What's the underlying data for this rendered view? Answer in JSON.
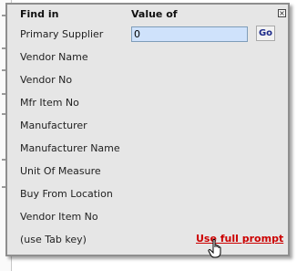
{
  "popup": {
    "header_find": "Find in",
    "header_value": "Value of",
    "close_icon": "close-icon",
    "fields": [
      "Primary Supplier",
      "Vendor Name",
      "Vendor No",
      "Mfr Item No",
      "Manufacturer",
      "Manufacturer Name",
      "Unit Of Measure",
      "Buy From Location",
      "Vendor Item No"
    ],
    "value_input": "0",
    "go_label": "Go",
    "hint": "(use Tab key)",
    "full_prompt_link": "Use full prompt",
    "cursor_icon": "hand-pointer-icon",
    "colors": {
      "link": "#cc0000",
      "input_bg": "#cfe2fb",
      "go_text": "#1c2a8a",
      "panel_bg": "#e6e6e6"
    }
  }
}
